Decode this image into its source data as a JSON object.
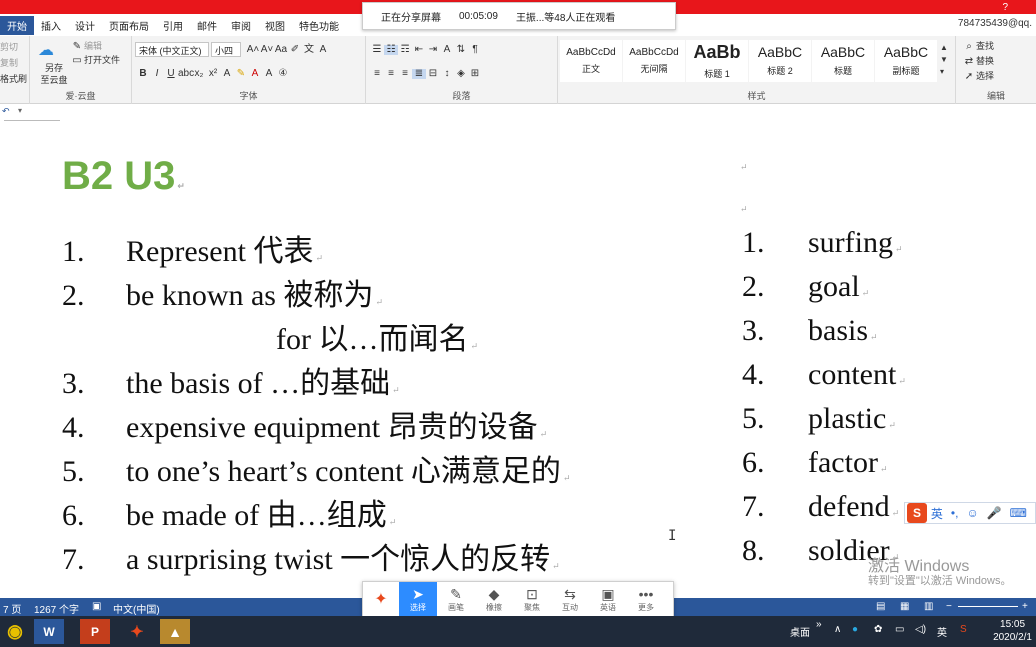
{
  "tabs": [
    "开始",
    "插入",
    "设计",
    "页面布局",
    "引用",
    "邮件",
    "审阅",
    "视图",
    "特色功能"
  ],
  "account": "784735439@qq.",
  "help": "?",
  "share": {
    "status": "正在分享屏幕",
    "timer": "00:05:09",
    "viewers": "王振...等48人正在观看"
  },
  "ribbon": {
    "clipboard": {
      "cut": "剪切",
      "copy": "复制",
      "painter": "格式刷"
    },
    "cloud": {
      "save": "另存\n至云盘",
      "edit": "编辑",
      "open": "打开文件",
      "group": "爱·云盘"
    },
    "font": {
      "name": "宋体 (中文正文)",
      "size": "小四",
      "group": "字体"
    },
    "paragraph": {
      "group": "段落"
    },
    "styles": {
      "group": "样式",
      "items": [
        {
          "sample": "AaBbCcDd",
          "name": "正文"
        },
        {
          "sample": "AaBbCcDd",
          "name": "无间隔"
        },
        {
          "sample": "AaBb",
          "name": "标题 1"
        },
        {
          "sample": "AaBbC",
          "name": "标题 2"
        },
        {
          "sample": "AaBbC",
          "name": "标题"
        },
        {
          "sample": "AaBbC",
          "name": "副标题"
        }
      ]
    },
    "editing": {
      "find": "查找",
      "replace": "替换",
      "select": "选择",
      "group": "编辑"
    }
  },
  "document": {
    "title": "B2 U3",
    "left_list": [
      {
        "num": "1.",
        "text": "Represent    代表"
      },
      {
        "num": "2.",
        "text": "be known as  被称为"
      },
      {
        "num": "",
        "text": "for  以…而闻名"
      },
      {
        "num": "3.",
        "text": "the basis of …的基础"
      },
      {
        "num": "4.",
        "text": "expensive equipment  昂贵的设备"
      },
      {
        "num": "5.",
        "text": "to one’s heart’s content  心满意足的"
      },
      {
        "num": "6.",
        "text": "be made of  由…组成"
      },
      {
        "num": "7.",
        "text": "a surprising twist  一个惊人的反转"
      }
    ],
    "right_list": [
      {
        "num": "1.",
        "text": "surfing"
      },
      {
        "num": "2.",
        "text": "goal"
      },
      {
        "num": "3.",
        "text": "basis"
      },
      {
        "num": "4.",
        "text": "content"
      },
      {
        "num": "5.",
        "text": "plastic"
      },
      {
        "num": "6.",
        "text": "factor"
      },
      {
        "num": "7.",
        "text": "defend"
      },
      {
        "num": "8.",
        "text": "soldier"
      }
    ]
  },
  "ime": {
    "lang": "英",
    "dot": "•,"
  },
  "watermark": {
    "line1": "激活 Windows",
    "line2": "转到\"设置\"以激活 Windows。"
  },
  "statusbar": {
    "page": "7 页",
    "words": "1267 个字",
    "language": "中文(中国)"
  },
  "annotation_toolbar": [
    {
      "icon": "arrow",
      "label": "选择"
    },
    {
      "icon": "pen",
      "label": "画笔"
    },
    {
      "icon": "eraser",
      "label": "橡擦"
    },
    {
      "icon": "focus",
      "label": "聚焦"
    },
    {
      "icon": "interact",
      "label": "互动"
    },
    {
      "icon": "english",
      "label": "英语"
    },
    {
      "icon": "more",
      "label": "更多"
    }
  ],
  "taskbar": {
    "desktop": "桌面",
    "ime": "英",
    "time": "15:05",
    "date": "2020/2/1"
  }
}
